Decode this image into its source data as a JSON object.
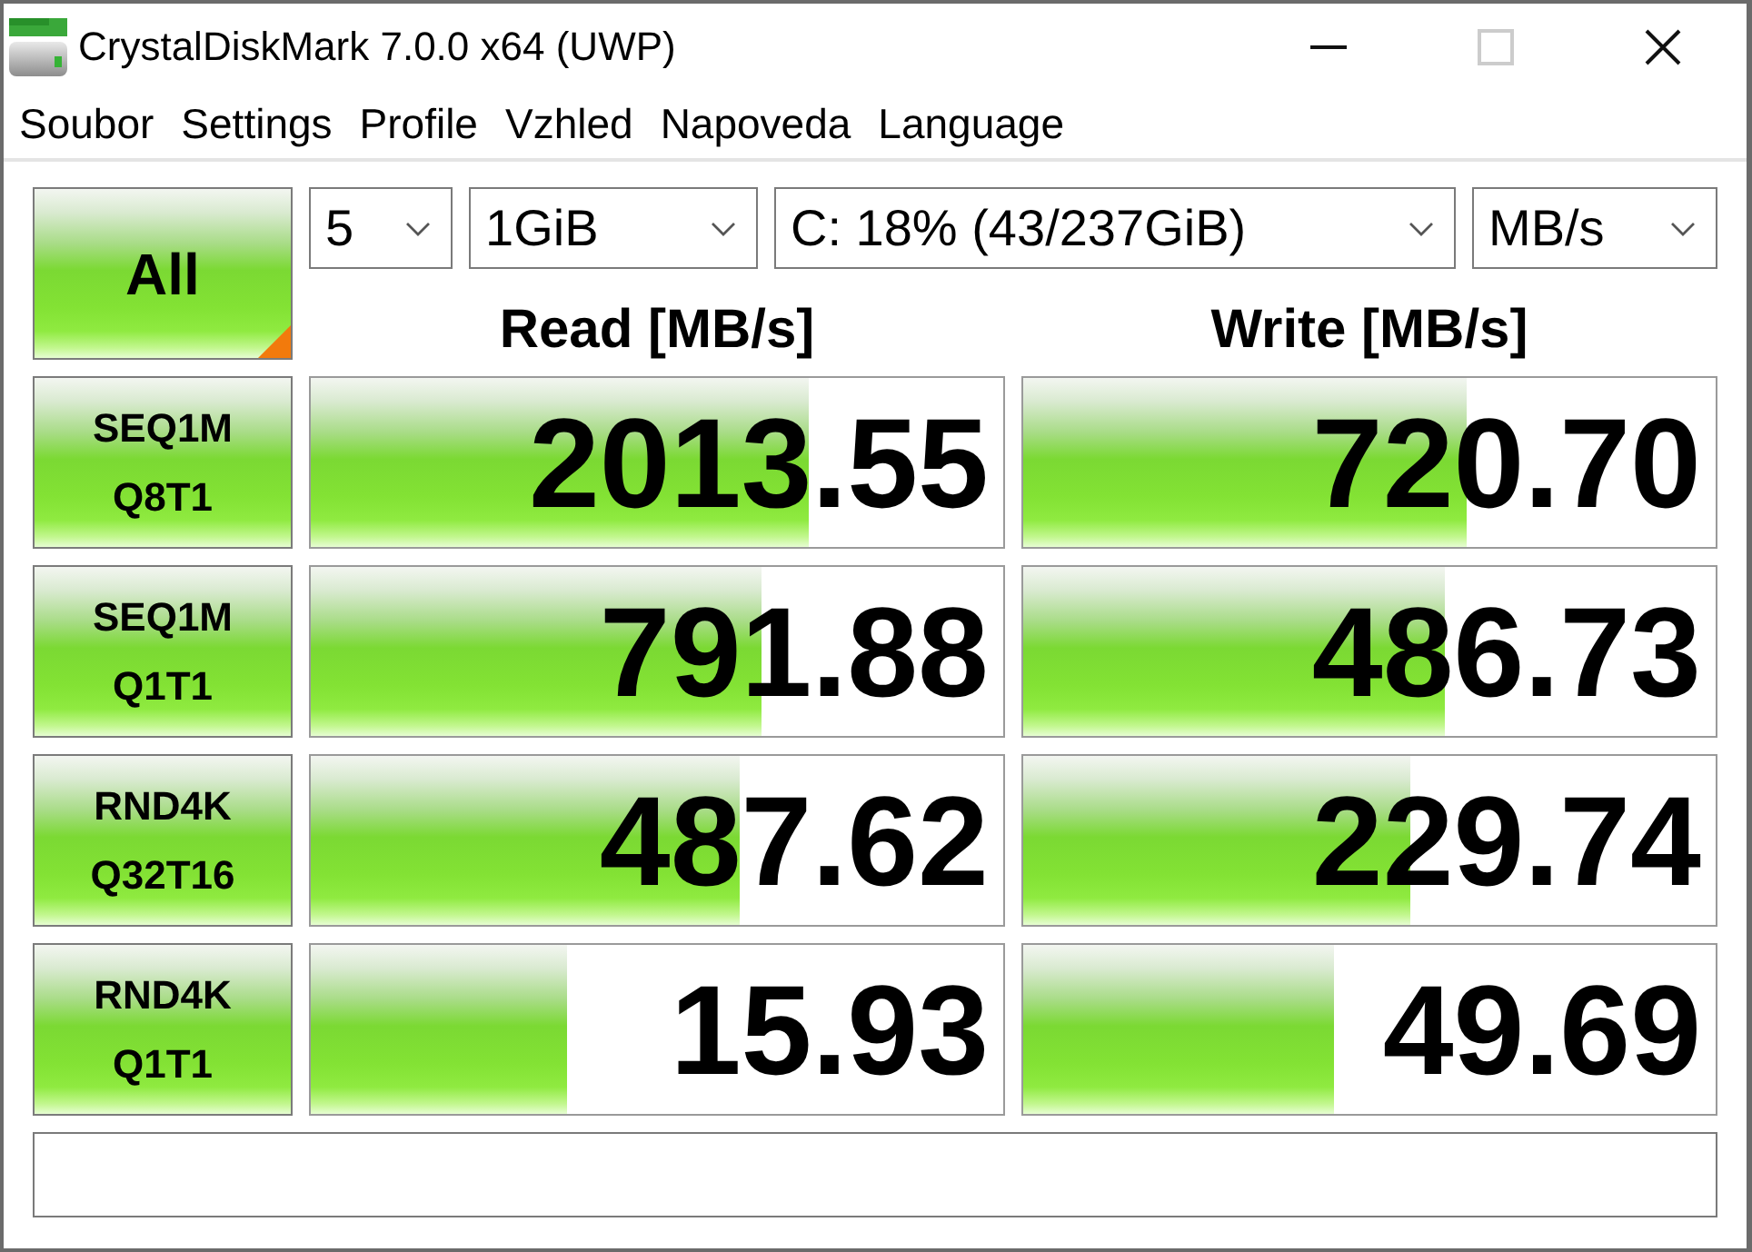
{
  "window": {
    "title": "CrystalDiskMark 7.0.0 x64 (UWP)",
    "buttons": [
      {
        "kind": "minimize",
        "disabled": false
      },
      {
        "kind": "maximize",
        "disabled": true
      },
      {
        "kind": "close",
        "disabled": false
      }
    ]
  },
  "menu": [
    "Soubor",
    "Settings",
    "Profile",
    "Vzhled",
    "Napoveda",
    "Language"
  ],
  "run_all_button": {
    "label": "All"
  },
  "settings": [
    {
      "kind": "count",
      "value": "5"
    },
    {
      "kind": "size",
      "value": "1GiB"
    },
    {
      "kind": "drive",
      "value": "C: 18% (43/237GiB)"
    },
    {
      "kind": "unit",
      "value": "MB/s"
    }
  ],
  "columns": [
    "Read [MB/s]",
    "Write [MB/s]"
  ],
  "tests": [
    {
      "name": "SEQ1M",
      "params": "Q8T1",
      "read": {
        "value": "2013.55",
        "level": 0.72
      },
      "write": {
        "value": "720.70",
        "level": 0.64
      }
    },
    {
      "name": "SEQ1M",
      "params": "Q1T1",
      "read": {
        "value": "791.88",
        "level": 0.65
      },
      "write": {
        "value": "486.73",
        "level": 0.61
      }
    },
    {
      "name": "RND4K",
      "params": "Q32T16",
      "read": {
        "value": "487.62",
        "level": 0.62
      },
      "write": {
        "value": "229.74",
        "level": 0.56
      }
    },
    {
      "name": "RND4K",
      "params": "Q1T1",
      "read": {
        "value": "15.93",
        "level": 0.37
      },
      "write": {
        "value": "49.69",
        "level": 0.45
      }
    }
  ]
}
